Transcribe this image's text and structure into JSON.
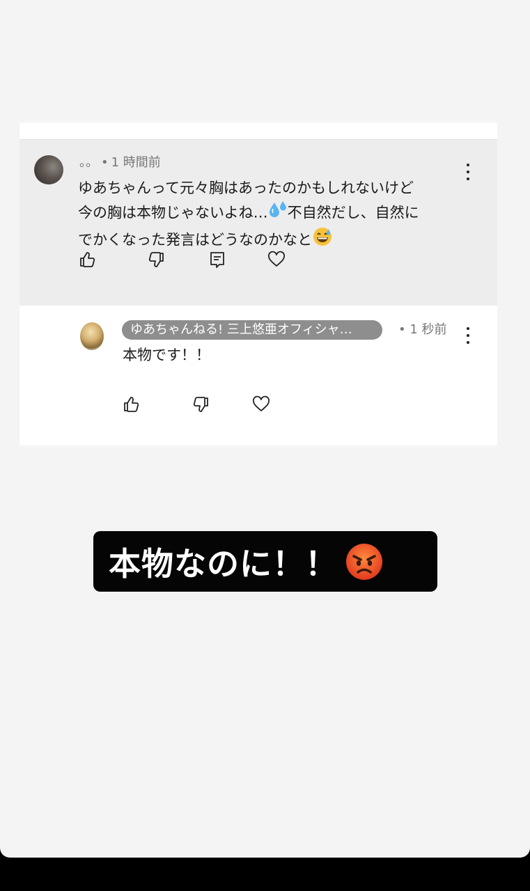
{
  "comment": {
    "author": "。。",
    "time": "1 時間前",
    "text_line1": "ゆあちゃんって元々胸はあったのかもしれないけど",
    "text_line2a": "今の胸は本物じゃないよね…",
    "text_line2b": "不自然だし、自然に",
    "text_line3": "でかくなった発言はどうなのかなと",
    "emoji_1": "sweat-droplets",
    "emoji_2": "grinning-sweat-face"
  },
  "reply": {
    "channel": "ゆあちゃんねる! 三上悠亜オフィシャ…",
    "time": "1 秒前",
    "text": "本物です！！"
  },
  "caption": {
    "text": "本物なのに！！",
    "emoji": "angry-face"
  },
  "icons": {
    "like": "thumbs-up-icon",
    "dislike": "thumbs-down-icon",
    "reply": "comment-icon",
    "heart": "heart-icon",
    "more": "kebab-icon"
  },
  "colors": {
    "comment_bg": "#ededed",
    "badge_bg": "#8e8e8e",
    "caption_bg": "#050505"
  }
}
